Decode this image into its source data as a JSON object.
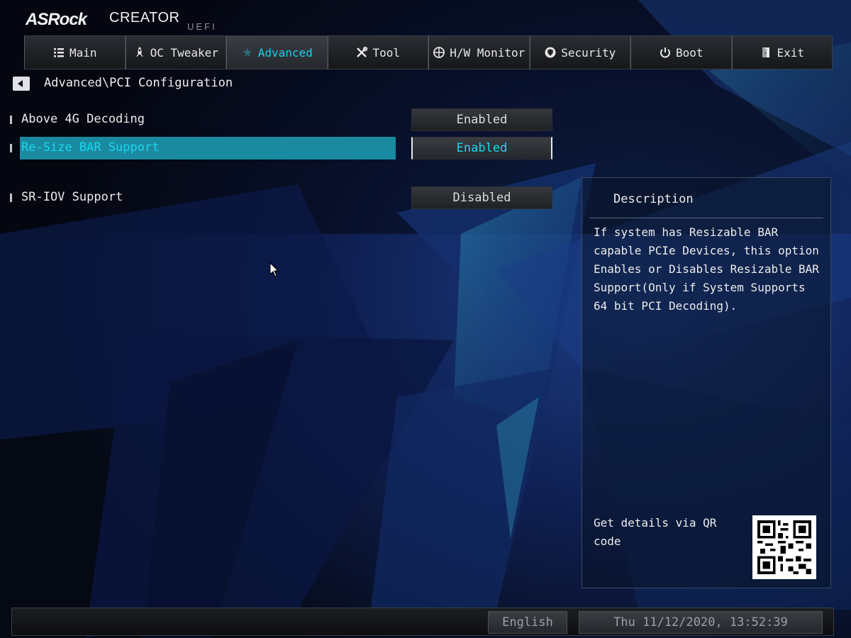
{
  "brand": {
    "logo": "ASRock",
    "product": "CREATOR",
    "firmware": "UEFI"
  },
  "tabs": [
    {
      "label": "Main",
      "icon": "list-icon"
    },
    {
      "label": "OC Tweaker",
      "icon": "rocket-icon"
    },
    {
      "label": "Advanced",
      "icon": "star-icon",
      "active": true
    },
    {
      "label": "Tool",
      "icon": "tools-icon"
    },
    {
      "label": "H/W Monitor",
      "icon": "crosshair-icon"
    },
    {
      "label": "Security",
      "icon": "shield-icon"
    },
    {
      "label": "Boot",
      "icon": "power-icon"
    },
    {
      "label": "Exit",
      "icon": "door-icon"
    }
  ],
  "breadcrumb": {
    "path": "Advanced\\PCI Configuration"
  },
  "settings": [
    {
      "label": "Above 4G Decoding",
      "value": "Enabled"
    },
    {
      "label": "Re-Size BAR Support",
      "value": "Enabled",
      "selected": true
    },
    {
      "label": "SR-IOV Support",
      "value": "Disabled"
    }
  ],
  "description": {
    "title": "Description",
    "lines": [
      "If system has Resizable BAR",
      "capable PCIe Devices, this option",
      "Enables or Disables Resizable BAR",
      "Support(Only if System Supports",
      "64 bit PCI Decoding)."
    ],
    "qr_note": [
      "Get details via QR",
      "code"
    ]
  },
  "footer": {
    "language": "English",
    "datetime": "Thu 11/12/2020, 13:52:39"
  },
  "colors": {
    "accent": "#19d8f0",
    "highlight": "#1a8aa0",
    "background": "#060a18"
  }
}
